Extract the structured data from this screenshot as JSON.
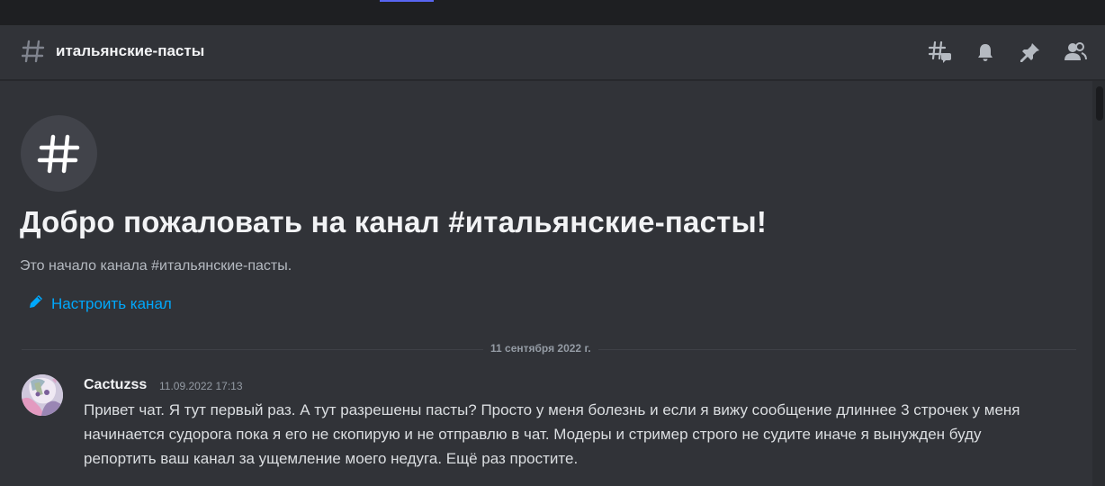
{
  "channel": {
    "name": "итальянские-пасты"
  },
  "header_tools": [
    "threads-icon",
    "notification-bell-icon",
    "pin-icon",
    "member-list-icon"
  ],
  "welcome": {
    "title": "Добро пожаловать на канал #итальянские-пасты!",
    "subtitle": "Это начало канала #итальянские-пасты.",
    "setup_link": "Настроить канал"
  },
  "date_divider": "11 сентября 2022 г.",
  "messages": [
    {
      "author": "Cactuzss",
      "timestamp": "11.09.2022 17:13",
      "text": "Привет чат. Я тут первый раз. А тут разрешены пасты? Просто у меня болезнь и если я вижу сообщение длиннее 3 строчек у меня начинается судорога пока я его не скопирую и не отправлю в чат. Модеры и стример строго не судите иначе я вынужден буду репортить ваш канал за ущемление моего недуга. Ещё раз простите."
    }
  ],
  "colors": {
    "background": "#313338",
    "link": "#00a8fc",
    "accent": "#5865f2"
  }
}
